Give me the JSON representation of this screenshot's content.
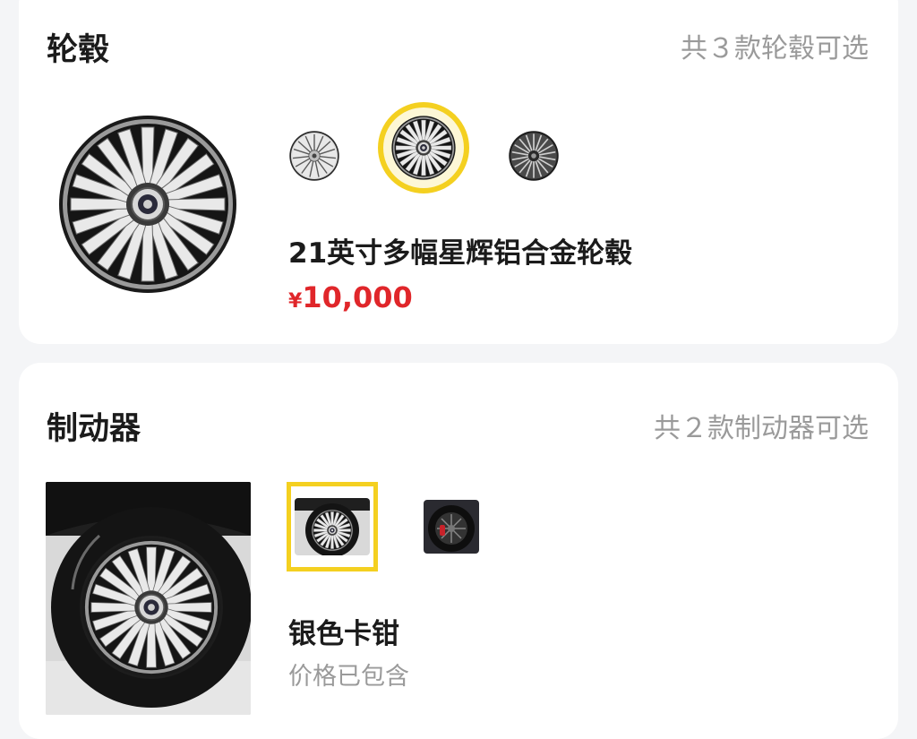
{
  "wheels": {
    "title": "轮毂",
    "count_text": "共３款轮毂可选",
    "options": [
      {
        "style": "chrome-silver",
        "selected": false
      },
      {
        "style": "two-tone-multi-spoke",
        "selected": true
      },
      {
        "style": "dark-grey",
        "selected": false
      }
    ],
    "selected_name": "21英寸多幅星辉铝合金轮毂",
    "price_symbol": "¥",
    "price_amount": "10,000"
  },
  "brakes": {
    "title": "制动器",
    "count_text": "共２款制动器可选",
    "options": [
      {
        "caliper": "silver",
        "selected": true
      },
      {
        "caliper": "red",
        "selected": false
      }
    ],
    "selected_name": "银色卡钳",
    "price_note": "价格已包含"
  },
  "colors": {
    "accent": "#f4d020",
    "price": "#e0262a",
    "muted_text": "#9a9a9a",
    "card_bg": "#ffffff",
    "page_bg": "#f4f5f7"
  }
}
